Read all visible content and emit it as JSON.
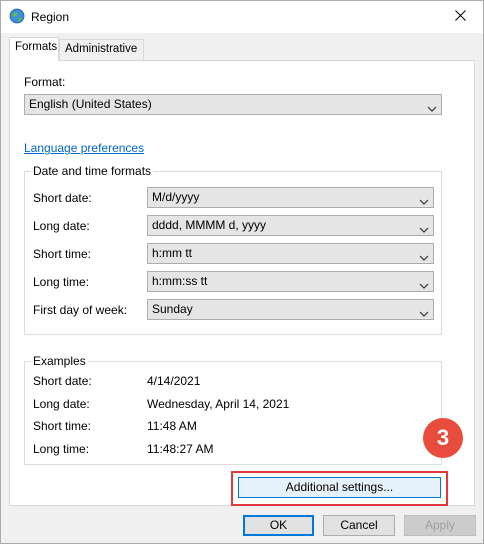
{
  "window": {
    "title": "Region",
    "icon": "globe-region-icon",
    "close_icon": "close-icon"
  },
  "tabs": [
    {
      "label": "Formats",
      "active": true
    },
    {
      "label": "Administrative",
      "active": false
    }
  ],
  "format": {
    "label": "Format:",
    "value": "English (United States)"
  },
  "language_link": "Language preferences",
  "date_time_formats": {
    "title": "Date and time formats",
    "rows": [
      {
        "label": "Short date:",
        "value": "M/d/yyyy"
      },
      {
        "label": "Long date:",
        "value": "dddd, MMMM d, yyyy"
      },
      {
        "label": "Short time:",
        "value": "h:mm tt"
      },
      {
        "label": "Long time:",
        "value": "h:mm:ss tt"
      },
      {
        "label": "First day of week:",
        "value": "Sunday"
      }
    ]
  },
  "examples": {
    "title": "Examples",
    "rows": [
      {
        "label": "Short date:",
        "value": "4/14/2021"
      },
      {
        "label": "Long date:",
        "value": "Wednesday, April 14, 2021"
      },
      {
        "label": "Short time:",
        "value": "11:48 AM"
      },
      {
        "label": "Long time:",
        "value": "11:48:27 AM"
      }
    ]
  },
  "additional_settings_label": "Additional settings...",
  "step_badge": "3",
  "footer": {
    "ok_label": "OK",
    "cancel_label": "Cancel",
    "apply_label": "Apply"
  },
  "colors": {
    "highlight": "#e0393e",
    "badge": "#e84c3d",
    "link": "#0066cc",
    "accent": "#0078d7"
  }
}
